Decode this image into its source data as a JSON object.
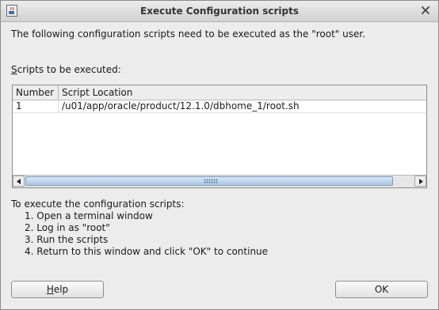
{
  "window": {
    "title": "Execute Configuration scripts",
    "app_icon": "java-app-icon",
    "close_icon": "close-icon"
  },
  "intro_text": "The following configuration scripts need to be executed as the \"root\" user.",
  "scripts_label": {
    "mnemonic": "S",
    "rest": "cripts to be executed:"
  },
  "table": {
    "columns": [
      "Number",
      "Script Location"
    ],
    "rows": [
      {
        "number": "1",
        "location": "/u01/app/oracle/product/12.1.0/dbhome_1/root.sh"
      }
    ]
  },
  "scrollbar": {
    "left_icon": "arrow-left-icon",
    "right_icon": "arrow-right-icon"
  },
  "instructions": {
    "heading": "To execute the configuration scripts:",
    "steps": [
      "1. Open a terminal window",
      "2. Log in as \"root\"",
      "3. Run the scripts",
      "4. Return to this window and click \"OK\" to continue"
    ]
  },
  "buttons": {
    "help_mnemonic": "H",
    "help_rest": "elp",
    "ok": "OK"
  }
}
